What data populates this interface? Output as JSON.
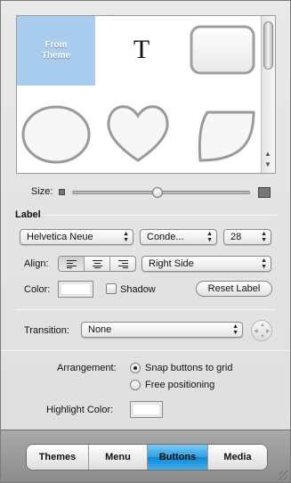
{
  "gallery": {
    "from_theme_label": "From\nTheme",
    "text_tile": "T",
    "shapes": [
      "rounded-rectangle",
      "oval",
      "heart",
      "leaf"
    ]
  },
  "size": {
    "label": "Size:",
    "slider_value": 0.47
  },
  "label_section": {
    "title": "Label",
    "font_family": "Helvetica Neue",
    "font_style": "Conde...",
    "font_size": "28",
    "align_label": "Align:",
    "align_options": [
      "left-align",
      "center-align",
      "right-align"
    ],
    "position": "Right Side",
    "color_label": "Color:",
    "shadow_label": "Shadow",
    "shadow_checked": false,
    "reset_button": "Reset Label"
  },
  "transition": {
    "label": "Transition:",
    "value": "None"
  },
  "arrangement": {
    "label": "Arrangement:",
    "options": [
      "Snap buttons to grid",
      "Free positioning"
    ],
    "selected": 0
  },
  "highlight": {
    "label": "Highlight Color:"
  },
  "tabs": [
    "Themes",
    "Menu",
    "Buttons",
    "Media"
  ],
  "active_tab": "Buttons",
  "colors": {
    "selection": "#a9cdee",
    "active_tab": "#2e9fe0"
  }
}
